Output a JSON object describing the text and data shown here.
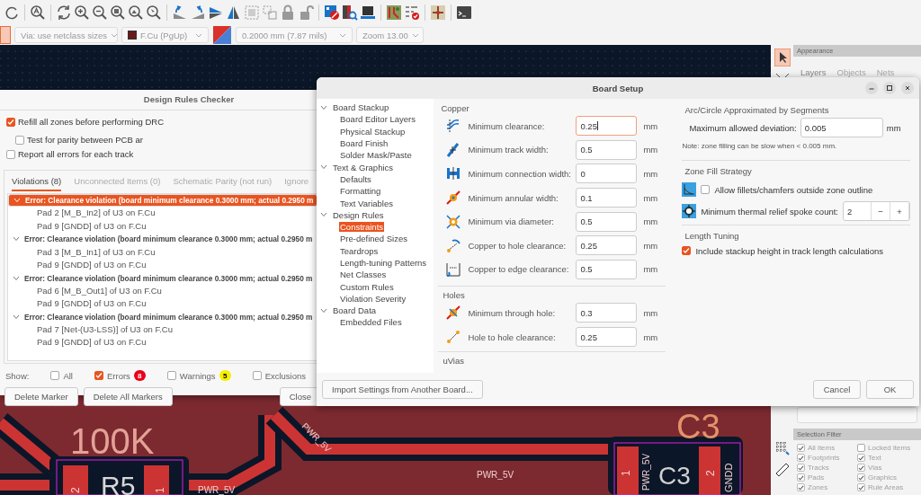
{
  "toolbar": {
    "selectors": [
      {
        "kind": "dropdown",
        "value": "Via: use netclass sizes",
        "disabled": true
      },
      {
        "kind": "layer",
        "value": "F.Cu (PgUp)",
        "disabled": true
      },
      {
        "kind": "dropdown",
        "value": "0.2000 mm (7.87 mils)",
        "disabled": true
      },
      {
        "kind": "dropdown",
        "value": "Zoom 13.00",
        "disabled": true
      }
    ]
  },
  "pcb": {
    "labels": [
      "100K",
      "PWR_5V",
      "C3",
      "2",
      "R5",
      "1",
      "PWR_5V",
      "PWR_5V",
      "1",
      "PWR_5V",
      "C3",
      "2",
      "GNDD"
    ]
  },
  "appearance": {
    "title": "Appearance",
    "tabs": [
      {
        "label": "Layers",
        "selected": true
      },
      {
        "label": "Objects",
        "selected": false
      },
      {
        "label": "Nets",
        "selected": false
      }
    ]
  },
  "selection_filter": {
    "title": "Selection Filter",
    "items": [
      {
        "label": "All items",
        "checked": true
      },
      {
        "label": "Locked items",
        "checked": false
      },
      {
        "label": "Footprints",
        "checked": true
      },
      {
        "label": "Text",
        "checked": true
      },
      {
        "label": "Tracks",
        "checked": true
      },
      {
        "label": "Vias",
        "checked": true
      },
      {
        "label": "Pads",
        "checked": true
      },
      {
        "label": "Graphics",
        "checked": true
      },
      {
        "label": "Zones",
        "checked": true
      },
      {
        "label": "Rule Areas",
        "checked": true
      }
    ]
  },
  "drc": {
    "title": "Design Rules Checker",
    "options": [
      {
        "label": "Refill all zones before performing DRC",
        "checked": true
      },
      {
        "label": "Test for parity between PCB ar",
        "checked": false
      },
      {
        "label": "Report all errors for each track",
        "checked": false
      }
    ],
    "tabs": [
      {
        "label": "Violations (8)",
        "selected": true
      },
      {
        "label": "Unconnected Items (0)",
        "selected": false
      },
      {
        "label": "Schematic Parity (not run)",
        "selected": false
      },
      {
        "label": "Ignore",
        "selected": false
      }
    ],
    "violations": [
      {
        "text": "Error: Clearance violation (board minimum clearance 0.3000 mm; actual 0.2950 m",
        "expanded": true,
        "selected": true,
        "children": [
          {
            "text": "Pad 2 [M_B_In2] of U3 on F.Cu"
          },
          {
            "text": "Pad 9 [GNDD] of U3 on F.Cu"
          }
        ]
      },
      {
        "text": "Error: Clearance violation (board minimum clearance 0.3000 mm; actual 0.2950 m",
        "expanded": true,
        "selected": false,
        "children": [
          {
            "text": "Pad 3 [M_B_In1] of U3 on F.Cu"
          },
          {
            "text": "Pad 9 [GNDD] of U3 on F.Cu"
          }
        ]
      },
      {
        "text": "Error: Clearance violation (board minimum clearance 0.3000 mm; actual 0.2950 m",
        "expanded": true,
        "selected": false,
        "children": [
          {
            "text": "Pad 6 [M_B_Out1] of U3 on F.Cu"
          },
          {
            "text": "Pad 9 [GNDD] of U3 on F.Cu"
          }
        ]
      },
      {
        "text": "Error: Clearance violation (board minimum clearance 0.3000 mm; actual 0.2950 m",
        "expanded": true,
        "selected": false,
        "children": [
          {
            "text": "Pad 7 [Net-(U3-LSS)] of U3 on F.Cu"
          },
          {
            "text": "Pad 9 [GNDD] of U3 on F.Cu"
          }
        ]
      }
    ],
    "show_label": "Show:",
    "filters": [
      {
        "label": "All",
        "checked": false
      },
      {
        "label": "Errors",
        "checked": true,
        "count": "8",
        "color": "#e8001c"
      },
      {
        "label": "Warnings",
        "checked": false,
        "count": "5",
        "color": "#f5f000"
      },
      {
        "label": "Exclusions",
        "checked": false
      }
    ],
    "buttons": [
      "Delete Marker",
      "Delete All Markers",
      "Close"
    ]
  },
  "board_setup": {
    "title": "Board Setup",
    "tree": [
      {
        "label": "Board Stackup",
        "expanded": true,
        "children": [
          {
            "label": "Board Editor Layers",
            "selected": false
          },
          {
            "label": "Physical Stackup",
            "selected": false
          },
          {
            "label": "Board Finish",
            "selected": false
          },
          {
            "label": "Solder Mask/Paste",
            "selected": false
          }
        ]
      },
      {
        "label": "Text & Graphics",
        "expanded": true,
        "children": [
          {
            "label": "Defaults",
            "selected": false
          },
          {
            "label": "Formatting",
            "selected": false
          },
          {
            "label": "Text Variables",
            "selected": false
          }
        ]
      },
      {
        "label": "Design Rules",
        "expanded": true,
        "children": [
          {
            "label": "Constraints",
            "selected": true
          },
          {
            "label": "Pre-defined Sizes",
            "selected": false
          },
          {
            "label": "Teardrops",
            "selected": false
          },
          {
            "label": "Length-tuning Patterns",
            "selected": false
          },
          {
            "label": "Net Classes",
            "selected": false
          },
          {
            "label": "Custom Rules",
            "selected": false
          },
          {
            "label": "Violation Severity",
            "selected": false
          }
        ]
      },
      {
        "label": "Board Data",
        "expanded": true,
        "children": [
          {
            "label": "Embedded Files",
            "selected": false
          }
        ]
      }
    ],
    "sections": [
      {
        "title": "Copper",
        "rows": [
          {
            "label": "Minimum clearance:",
            "value": "0.25",
            "unit": "mm",
            "focused": true
          },
          {
            "label": "Minimum track width:",
            "value": "0.5",
            "unit": "mm",
            "focused": false
          },
          {
            "label": "Minimum connection width:",
            "value": "0",
            "unit": "mm",
            "focused": false
          },
          {
            "label": "Minimum annular width:",
            "value": "0.1",
            "unit": "mm",
            "focused": false
          },
          {
            "label": "Minimum via diameter:",
            "value": "0.5",
            "unit": "mm",
            "focused": false
          },
          {
            "label": "Copper to hole clearance:",
            "value": "0.25",
            "unit": "mm",
            "focused": false
          },
          {
            "label": "Copper to edge clearance:",
            "value": "0.5",
            "unit": "mm",
            "focused": false
          }
        ]
      },
      {
        "title": "Holes",
        "rows": [
          {
            "label": "Minimum through hole:",
            "value": "0.3",
            "unit": "mm",
            "focused": false
          },
          {
            "label": "Hole to hole clearance:",
            "value": "0.25",
            "unit": "mm",
            "focused": false
          }
        ]
      },
      {
        "title": "uVias"
      }
    ],
    "arc": {
      "title": "Arc/Circle Approximated by Segments",
      "label": "Maximum allowed deviation:",
      "value": "0.005",
      "unit": "mm",
      "note": "Note: zone filling can be slow when < 0.005 mm."
    },
    "zone_fill": {
      "title": "Zone Fill Strategy",
      "fillets": {
        "label": "Allow fillets/chamfers outside zone outline",
        "checked": false
      },
      "spokes": {
        "label": "Minimum thermal relief spoke count:",
        "value": "2",
        "minus": "−",
        "plus": "+"
      }
    },
    "length_tuning": {
      "title": "Length Tuning",
      "stackup": {
        "label": "Include stackup height in track length calculations",
        "checked": true
      }
    },
    "import_button": "Import Settings from Another Board...",
    "buttons": [
      "Cancel",
      "OK"
    ]
  }
}
